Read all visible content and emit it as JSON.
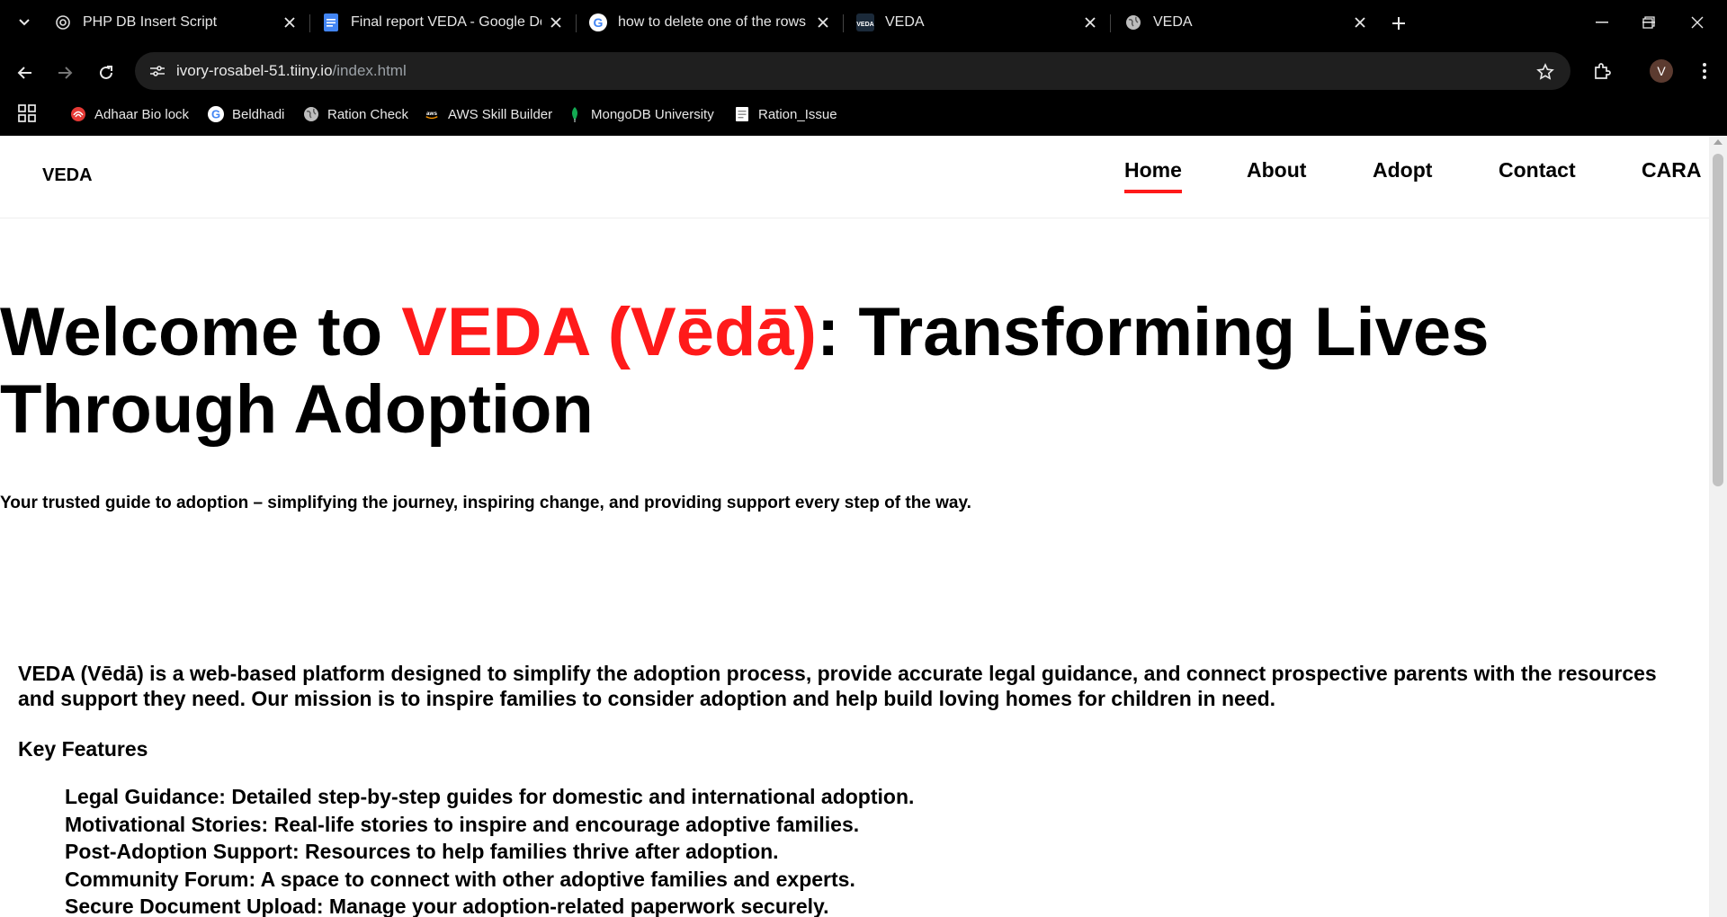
{
  "browser": {
    "tabs": [
      {
        "title": "PHP DB Insert Script",
        "icon": "openai-icon"
      },
      {
        "title": "Final report VEDA - Google Docs",
        "icon": "google-docs-icon"
      },
      {
        "title": "how to delete one of the rows in",
        "icon": "google-icon"
      },
      {
        "title": "VEDA",
        "icon": "veda-favicon"
      },
      {
        "title": "VEDA",
        "icon": "globe-icon"
      }
    ],
    "url_host": "ivory-rosabel-51.tiiny.io",
    "url_path": "/index.html",
    "profile_initial": "V",
    "bookmarks": [
      {
        "label": "Adhaar Bio lock",
        "icon": "aadhaar-icon"
      },
      {
        "label": "Beldhadi",
        "icon": "google-icon"
      },
      {
        "label": "Ration Check",
        "icon": "globe-icon"
      },
      {
        "label": "AWS Skill Builder",
        "icon": "aws-icon"
      },
      {
        "label": "MongoDB University",
        "icon": "mongodb-leaf-icon"
      },
      {
        "label": "Ration_Issue",
        "icon": "document-icon"
      }
    ]
  },
  "site": {
    "logo": "VEDA",
    "nav": [
      "Home",
      "About",
      "Adopt",
      "Contact",
      "CARA"
    ],
    "active_nav": "Home",
    "accent_color": "#ff1a1a",
    "hero": {
      "title_prefix": "Welcome to ",
      "title_accent": "VEDA (Vēdā)",
      "title_suffix": ": Transforming Lives Through Adoption",
      "subtitle": "Your trusted guide to adoption – simplifying the journey, inspiring change, and providing support every step of the way."
    },
    "about": "VEDA (Vēdā) is a web-based platform designed to simplify the adoption process, provide accurate legal guidance, and connect prospective parents with the resources and support they need. Our mission is to inspire families to consider adoption and help build loving homes for children in need.",
    "features_title": "Key Features",
    "features": [
      "Legal Guidance: Detailed step-by-step guides for domestic and international adoption.",
      "Motivational Stories: Real-life stories to inspire and encourage adoptive families.",
      "Post-Adoption Support: Resources to help families thrive after adoption.",
      "Community Forum: A space to connect with other adoptive families and experts.",
      "Secure Document Upload: Manage your adoption-related paperwork securely."
    ]
  }
}
